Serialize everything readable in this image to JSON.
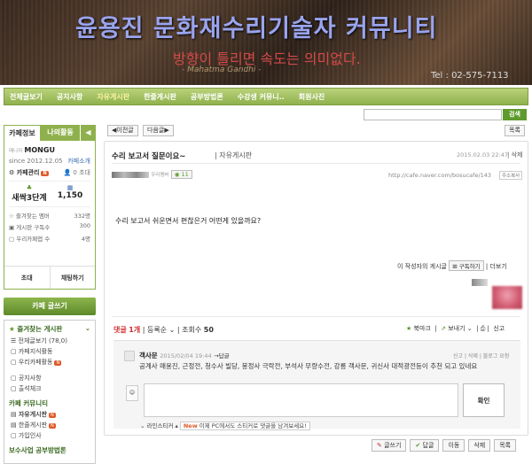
{
  "banner": {
    "title": "윤용진 문화재수리기술자 커뮤니티",
    "quote": "방향이 틀리면 속도는 의미없다.",
    "author": "- Mahatma Gandhi -",
    "tel": "Tel : 02-575-7113"
  },
  "nav": [
    "전체글보기",
    "공지사항",
    "자유게시판",
    "한줄게시판",
    "공부방법론",
    "수강생 커뮤니..",
    "회원사진"
  ],
  "search": {
    "button": "검색"
  },
  "sidebar": {
    "tabs": [
      "카페정보",
      "나의활동"
    ],
    "tab_more": "◀",
    "nick_prefix": "매니저",
    "nickname": "MONGU",
    "intro": "카페소개",
    "since": "since 2012.12.05",
    "manage": "카페관리",
    "invite": "초대",
    "invite_count": "0",
    "stats": [
      {
        "label": "프렌드",
        "value": "새싹3단계"
      },
      {
        "label": "",
        "value": "1,150"
      }
    ],
    "list": [
      {
        "label": "즐겨찾는 멤버",
        "value": "332명"
      },
      {
        "label": "게시판 구독수",
        "value": "300"
      },
      {
        "label": "우리카페앱 수",
        "value": "4명"
      }
    ],
    "btn_invite": "초대",
    "btn_chat": "채팅하기",
    "write": "카페 글쓰기",
    "fav_title": "즐겨찾는 게시판",
    "items1": [
      "전체글보기 (78,0)",
      "카페지식활동",
      "우리카페활동"
    ],
    "items2": [
      "공지사항",
      "출석체크"
    ],
    "sec_title": "카페 커뮤니티",
    "items3": [
      "자유게시판",
      "한줄게시판",
      "가입인사"
    ],
    "sec2_title": "보수사업 공부방법론"
  },
  "post": {
    "prev": "◀이전글",
    "next": "다음글▶",
    "list": "목록",
    "title": "수리 보고서 질문이요~",
    "category": "자유게시판",
    "date": "2015.02.03 22:47",
    "delete": "삭제",
    "author_label": "우리멤버",
    "comments": "11",
    "url": "http://cafe.naver.com/bosucafe/143",
    "copy": "주소복사",
    "body": "수리 보고서 쉬운면서 편찮은거 어떤게 있을까요?",
    "writer_line": "이 작성자의 게시글",
    "subscribe": "구독하기",
    "more": "더보기",
    "comment_label": "댓글",
    "comment_count": "1개",
    "reg": "등록순",
    "views_label": "조회수",
    "views": "50",
    "actions": [
      "북마크",
      "보내기",
      "신고"
    ],
    "comment": {
      "name": "객사문",
      "date": "2015/02/04 19:44",
      "reply": "→답글",
      "tools": "신고 | 삭제 | 블로그 요청",
      "text": "공계사 매용진, 근정전, 청수사 빌당, 봉정사 극락전, 부석사 무량수전, 강릉 객사문, 귀신사 대적광전등이 추천 되고 있네요"
    },
    "confirm": "확인",
    "sticker": "라인스티커",
    "sticker_new": "New",
    "sticker_msg": "이제 PC에서도 스티커로 댓글을 남겨보세요!",
    "bottom": [
      "글쓰기",
      "답글",
      "이동",
      "삭제",
      "목록"
    ]
  }
}
